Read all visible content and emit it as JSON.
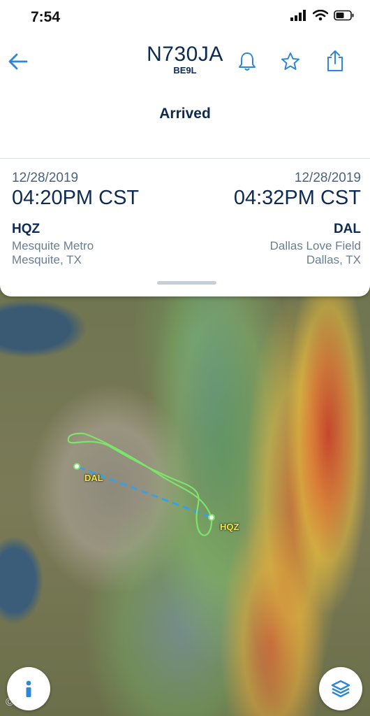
{
  "status_bar": {
    "time": "7:54"
  },
  "header": {
    "tail_number": "N730JA",
    "aircraft_type": "BE9L",
    "flight_status": "Arrived"
  },
  "departure": {
    "date": "12/28/2019",
    "time": "04:20PM CST",
    "code": "HQZ",
    "airport": "Mesquite Metro",
    "city": "Mesquite, TX"
  },
  "arrival": {
    "date": "12/28/2019",
    "time": "04:32PM CST",
    "code": "DAL",
    "airport": "Dallas Love Field",
    "city": "Dallas, TX"
  },
  "map": {
    "labels": {
      "origin": "HQZ",
      "destination": "DAL"
    },
    "credit": "© Maps"
  },
  "icons": {
    "back": "back-arrow-icon",
    "bell": "bell-icon",
    "star": "star-icon",
    "share": "share-icon",
    "info": "info-icon",
    "layers": "layers-icon"
  },
  "colors": {
    "navy": "#0d2a52",
    "accent": "#2f86d8",
    "label_yellow": "#f7e93b",
    "route_green": "#7de36a"
  }
}
